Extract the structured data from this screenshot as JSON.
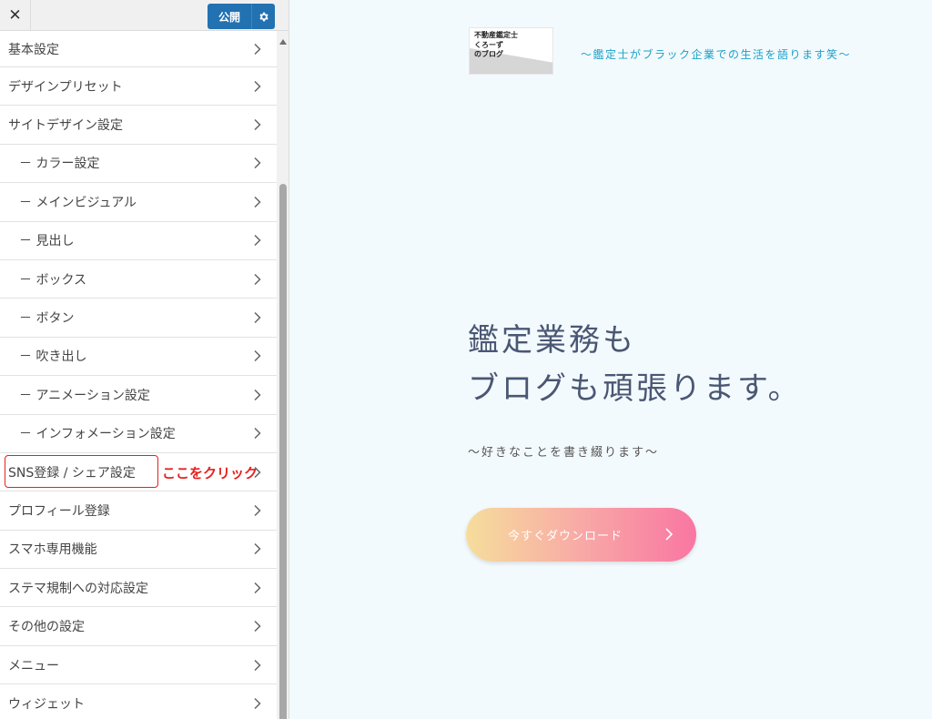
{
  "panel": {
    "close_label": "✕",
    "publish_label": "公開",
    "menu": [
      {
        "label": "基本設定",
        "sub": false
      },
      {
        "label": "デザインプリセット",
        "sub": false
      },
      {
        "label": "サイトデザイン設定",
        "sub": false
      },
      {
        "label": "－ カラー設定",
        "sub": true
      },
      {
        "label": "－ メインビジュアル",
        "sub": true
      },
      {
        "label": "－ 見出し",
        "sub": true
      },
      {
        "label": "－ ボックス",
        "sub": true
      },
      {
        "label": "－ ボタン",
        "sub": true
      },
      {
        "label": "－ 吹き出し",
        "sub": true
      },
      {
        "label": "－ アニメーション設定",
        "sub": true
      },
      {
        "label": "－ インフォメーション設定",
        "sub": true
      },
      {
        "label": "SNS登録 / シェア設定",
        "sub": false
      },
      {
        "label": "プロフィール登録",
        "sub": false
      },
      {
        "label": "スマホ専用機能",
        "sub": false
      },
      {
        "label": "ステマ規制への対応設定",
        "sub": false
      },
      {
        "label": "その他の設定",
        "sub": false
      },
      {
        "label": "メニュー",
        "sub": false
      },
      {
        "label": "ウィジェット",
        "sub": false
      }
    ],
    "annotation": "ここをクリック"
  },
  "preview": {
    "logo_lines": [
      "不動産鑑定士",
      "くろーず",
      "のブログ"
    ],
    "tagline": "～鑑定士がブラック企業での生活を語ります笑～",
    "hero_line1": "鑑定業務も",
    "hero_line2": "ブログも頑張ります。",
    "hero_sub": "～好きなことを書き綴ります～",
    "cta_label": "今すぐダウンロード"
  },
  "colors": {
    "accent": "#2271b1",
    "annotation": "#e52020",
    "tagline": "#1ba1c8",
    "hero_text": "#4a5774",
    "cta_gradient": [
      "#f6de9c",
      "#f976a2"
    ]
  }
}
